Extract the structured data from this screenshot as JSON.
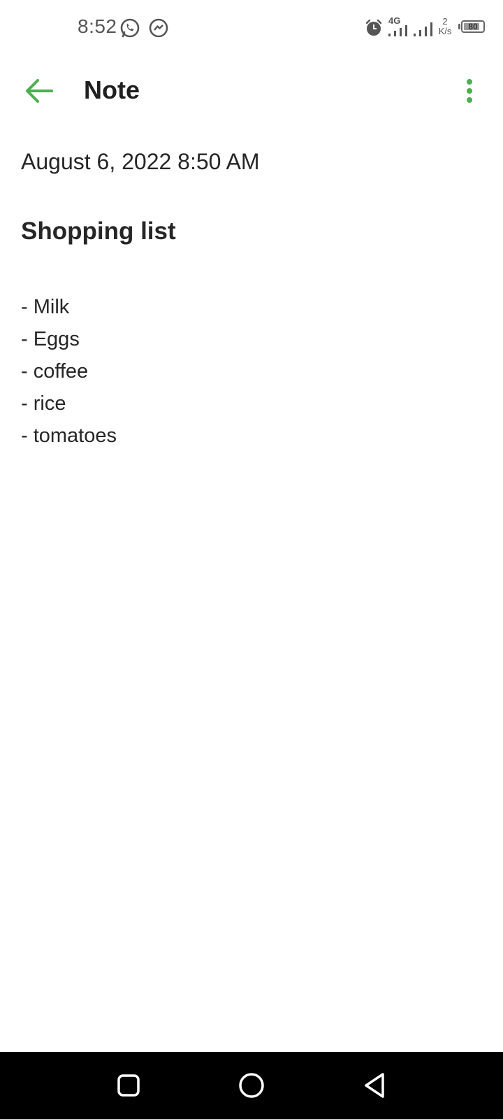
{
  "status_bar": {
    "time": "8:52",
    "network_type": "4G",
    "speed_value": "2",
    "speed_unit": "K/s",
    "battery": "80"
  },
  "toolbar": {
    "title": "Note",
    "accent_color": "#4caf50"
  },
  "note": {
    "date": "August 6, 2022 8:50 AM",
    "title": "Shopping list",
    "lines": [
      "- Milk",
      "- Eggs",
      "- coffee",
      "- rice",
      "- tomatoes"
    ]
  },
  "icons": {
    "back": "arrow-back-icon",
    "menu": "more-vert-icon",
    "whatsapp": "whatsapp-icon",
    "messenger": "messenger-icon",
    "alarm": "alarm-icon",
    "signal": "signal-icon",
    "nav_recents": "square-icon",
    "nav_home": "circle-icon",
    "nav_back": "triangle-back-icon"
  }
}
